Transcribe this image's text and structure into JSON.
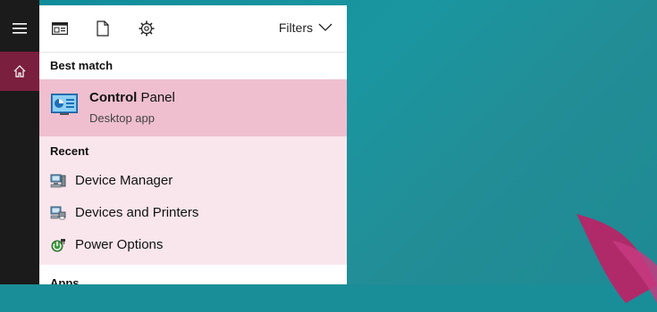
{
  "toolbar": {
    "icons": [
      "apps-view-icon",
      "document-icon",
      "settings-gear-icon"
    ],
    "filters_label": "Filters"
  },
  "sections": {
    "best_match": "Best match",
    "recent": "Recent",
    "apps": "Apps"
  },
  "best_match": {
    "title_bold": "Control",
    "title_rest": " Panel",
    "subtitle": "Desktop app"
  },
  "recent_items": [
    {
      "label": "Device Manager",
      "icon": "device-manager-icon"
    },
    {
      "label": "Devices and Printers",
      "icon": "devices-printers-icon"
    },
    {
      "label": "Power Options",
      "icon": "power-options-icon"
    }
  ],
  "colors": {
    "accent": "#7b1f3f",
    "selection": "#efbfcf",
    "panel_bg": "#f9e6ec",
    "rail_bg": "#1b1b1b"
  }
}
